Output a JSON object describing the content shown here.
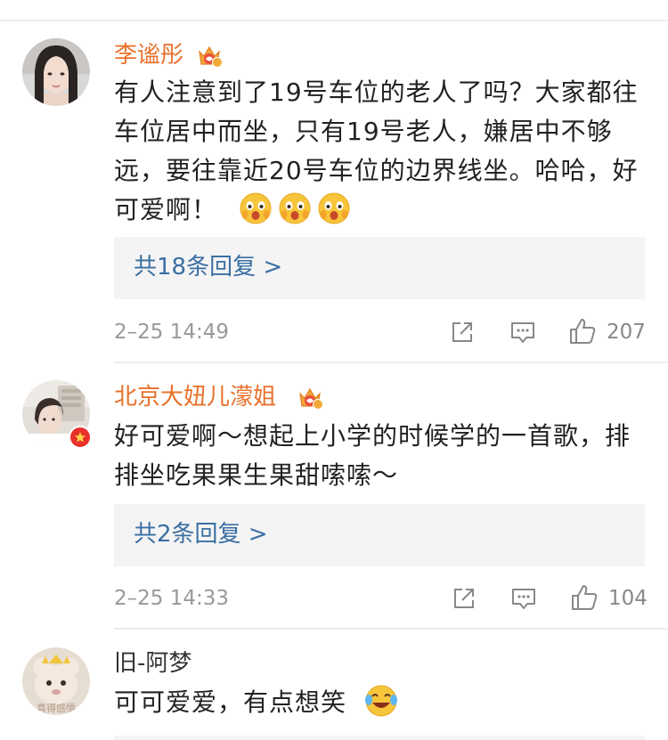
{
  "comments": [
    {
      "username": "李谧彤",
      "vip_badge": "vip-crown-icon",
      "text": "有人注意到了19号车位的老人了吗？大家都往车位居中而坐，只有19号老人，嫌居中不够远，要往靠近20号车位的边界线坐。哈哈，好可爱啊！",
      "emojis": [
        "surprised-face-emoji",
        "surprised-face-emoji",
        "surprised-face-emoji"
      ],
      "reply_link": "共18条回复 >",
      "time": "2–25 14:49",
      "likes": "207"
    },
    {
      "username": "北京大妞儿濛姐",
      "vip_badge": "vip-crown-icon",
      "text": "好可爱啊～想起上小学的时候学的一首歌，排排坐吃果果生果甜嗦嗦～",
      "reply_link": "共2条回复 >",
      "time": "2–25 14:33",
      "likes": "104"
    },
    {
      "username": "旧-阿梦",
      "avatar_text": "真得感情",
      "text": "可可爱爱，有点想笑",
      "emojis": [
        "laughing-crying-emoji"
      ]
    }
  ],
  "colors": {
    "username_vip": "#e8702a",
    "username_plain": "#333333",
    "reply_link": "#3a6fa3",
    "meta": "#999999",
    "reply_bg": "#f4f4f4",
    "badge_red": "#e8312a"
  }
}
